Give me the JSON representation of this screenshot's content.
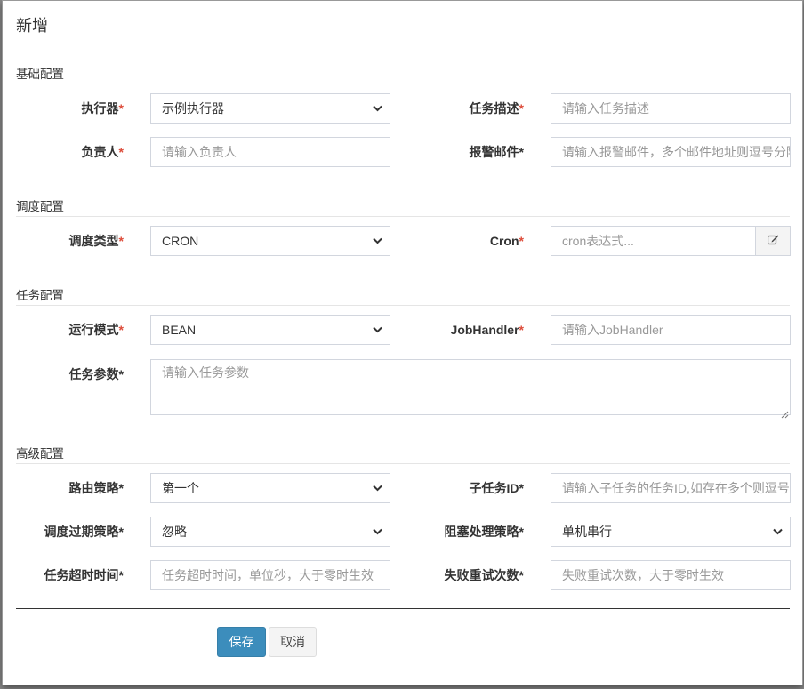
{
  "modal": {
    "title": "新增"
  },
  "sections": {
    "basic": "基础配置",
    "schedule": "调度配置",
    "task": "任务配置",
    "advanced": "高级配置"
  },
  "fields": {
    "executor": {
      "label": "执行器",
      "value": "示例执行器"
    },
    "job_desc": {
      "label": "任务描述",
      "placeholder": "请输入任务描述"
    },
    "author": {
      "label": "负责人",
      "placeholder": "请输入负责人"
    },
    "alarm_email": {
      "label": "报警邮件",
      "placeholder": "请输入报警邮件，多个邮件地址则逗号分隔"
    },
    "schedule_type": {
      "label": "调度类型",
      "value": "CRON"
    },
    "cron": {
      "label": "Cron",
      "placeholder": "cron表达式..."
    },
    "run_mode": {
      "label": "运行模式",
      "value": "BEAN"
    },
    "job_handler": {
      "label": "JobHandler",
      "placeholder": "请输入JobHandler"
    },
    "job_param": {
      "label": "任务参数",
      "placeholder": "请输入任务参数"
    },
    "route_strategy": {
      "label": "路由策略",
      "value": "第一个"
    },
    "child_job_id": {
      "label": "子任务ID",
      "placeholder": "请输入子任务的任务ID,如存在多个则逗号分隔"
    },
    "misfire_strategy": {
      "label": "调度过期策略",
      "value": "忽略"
    },
    "block_strategy": {
      "label": "阻塞处理策略",
      "value": "单机串行"
    },
    "timeout": {
      "label": "任务超时时间",
      "placeholder": "任务超时时间，单位秒，大于零时生效"
    },
    "fail_retry": {
      "label": "失败重试次数",
      "placeholder": "失败重试次数，大于零时生效"
    }
  },
  "required_mark": "*",
  "buttons": {
    "save": "保存",
    "cancel": "取消"
  },
  "icons": {
    "select_arrow": "chevron-down-icon",
    "cron_edit": "edit-icon"
  },
  "colors": {
    "required": "#dd4b39",
    "primary": "#3c8dbc"
  }
}
